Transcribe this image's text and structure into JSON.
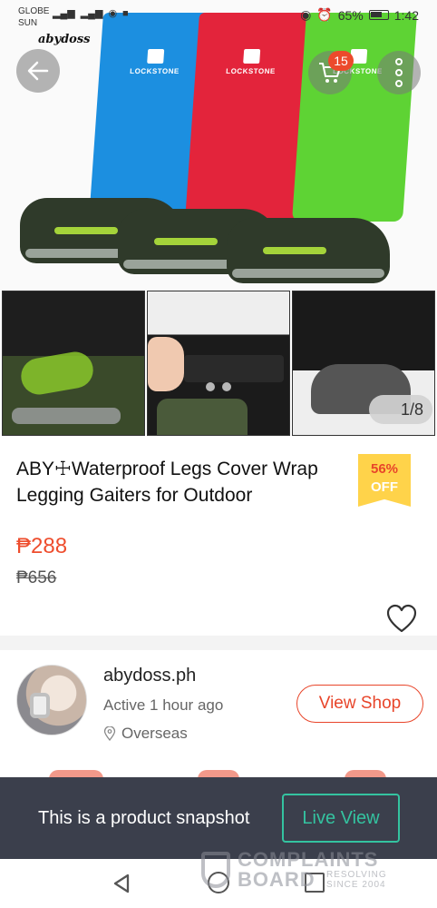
{
  "status_bar": {
    "carrier_1": "GLOBE",
    "carrier_2": "SUN",
    "battery": "65%",
    "time": "1:42"
  },
  "hero": {
    "brand_logo": "abydoss",
    "gaiter_label": "LOCKSTONE",
    "cart_count": "15",
    "image_counter": "1/8"
  },
  "product": {
    "title": "ABY☩Waterproof Legs Cover Wrap Legging Gaiters for Outdoor",
    "discount_percent": "56%",
    "discount_off": "OFF",
    "price": "₱288",
    "original_price": "₱656"
  },
  "shop": {
    "name": "abydoss.ph",
    "active": "Active 1 hour ago",
    "location": "Overseas",
    "view_shop_label": "View Shop"
  },
  "snapshot": {
    "message": "This is a product snapshot",
    "live_view_label": "Live View"
  },
  "watermark": {
    "line1": "COMPLAINTS",
    "line2": "BOARD",
    "tag1": "RESOLVING",
    "tag2": "SINCE 2004"
  },
  "colors": {
    "accent": "#ee4d2d",
    "discount_badge": "#ffd34a",
    "snapshot_bar": "#3b3f4c",
    "live_view": "#34c3a0"
  },
  "icons": [
    "back-arrow-icon",
    "cart-icon",
    "more-icon",
    "heart-icon",
    "location-pin-icon",
    "nav-back-icon",
    "nav-home-icon",
    "nav-recent-icon"
  ]
}
